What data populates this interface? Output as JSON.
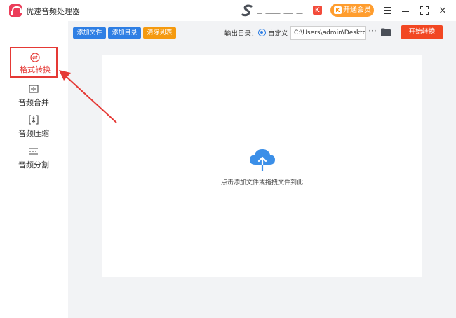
{
  "app": {
    "title": "优速音频处理器"
  },
  "titlebar": {
    "brand_badge": "K",
    "vip_label": "开通会员",
    "vip_icon": "K",
    "close_glyph": "×"
  },
  "sidebar": {
    "items": [
      {
        "label": "格式转换",
        "icon": "convert-icon",
        "active": true
      },
      {
        "label": "音频合并",
        "icon": "merge-icon"
      },
      {
        "label": "音频压缩",
        "icon": "compress-icon"
      },
      {
        "label": "音频分割",
        "icon": "split-icon"
      }
    ]
  },
  "toolbar": {
    "add_file": "添加文件",
    "add_dir": "添加目录",
    "clear_list": "清除列表",
    "output_dir_label": "输出目录：",
    "custom_option": "自定义",
    "output_path": "C:\\Users\\admin\\Deskto",
    "more": "···",
    "start": "开始转换"
  },
  "main": {
    "drop_hint": "点击添加文件或拖拽文件到此"
  },
  "colors": {
    "accent_blue": "#2f7fe4",
    "start_red": "#f24722",
    "clear_orange": "#f59a0f",
    "vip_orange": "#ff9d2e",
    "active_red": "#e53935"
  }
}
